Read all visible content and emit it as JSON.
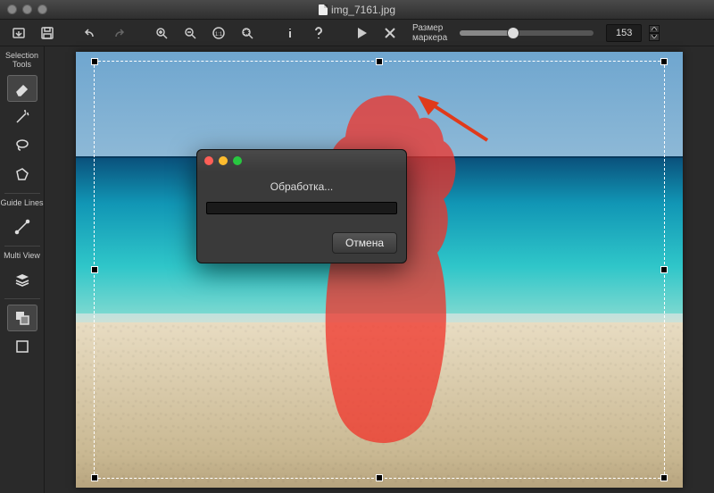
{
  "title": "img_7161.jpg",
  "toolbar": {
    "marker_label": "Размер\nмаркера",
    "marker_value": "153"
  },
  "sidebar": {
    "selection_label": "Selection\nTools",
    "guide_label": "Guide\nLines",
    "multi_label": "Multi\nView"
  },
  "dialog": {
    "title": "Обработка...",
    "cancel": "Отмена"
  }
}
